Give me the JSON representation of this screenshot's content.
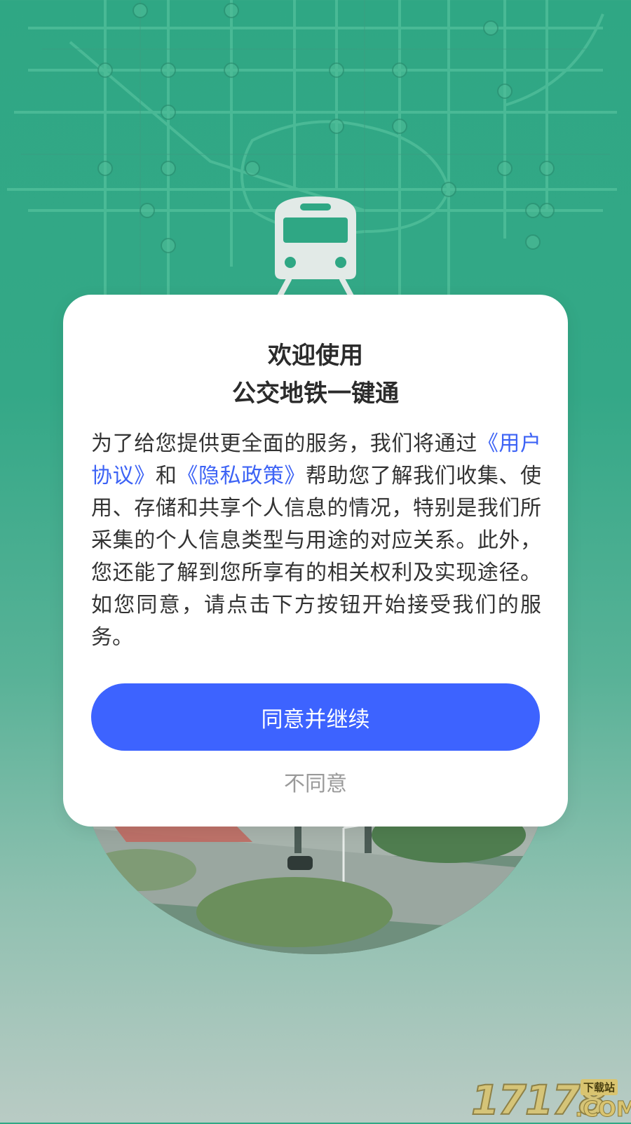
{
  "dialog": {
    "title_line1": "欢迎使用",
    "title_line2": "公交地铁一键通",
    "body_part1": "为了给您提供更全面的服务，我们将通过",
    "link_user_agreement": "《用户协议》",
    "body_part2": "和",
    "link_privacy_policy": "《隐私政策》",
    "body_part3": "帮助您了解我们收集、使用、存储和共享个人信息的情况，特别是我们所采集的个人信息类型与用途的对应关系。此外，您还能了解到您所享有的相关权利及实现途径。如您同意，请点击下方按钮开始接受我们的服务。",
    "agree_label": "同意并继续",
    "disagree_label": "不同意"
  },
  "watermark": {
    "digits": "17178",
    "tag": "下载站",
    "suffix": ".COM"
  },
  "colors": {
    "background_green": "#2fa784",
    "link_blue": "#3d63f5",
    "button_blue": "#3d63ff",
    "secondary_gray": "#9a9a9a"
  },
  "icons": {
    "train": "train-icon",
    "map": "metro-map-background"
  }
}
